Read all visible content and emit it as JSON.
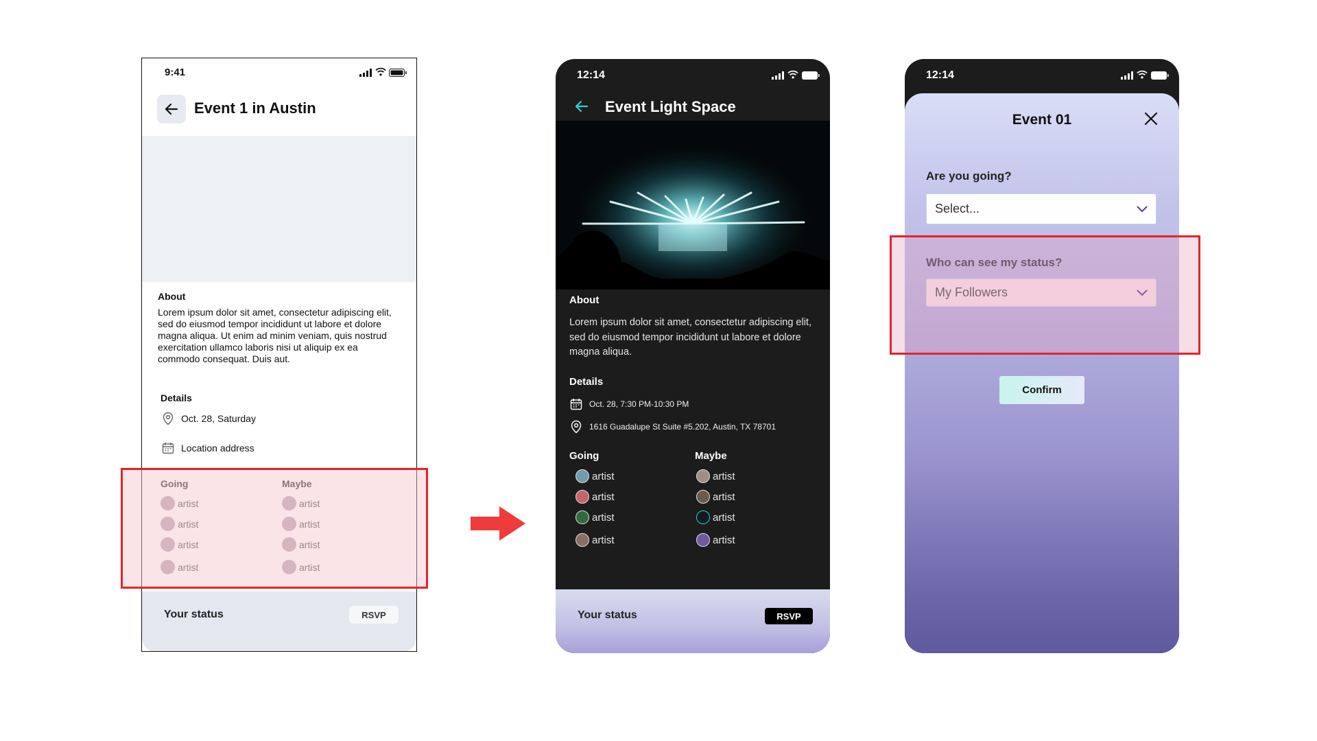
{
  "wireframe": {
    "time": "9:41",
    "title": "Event 1 in Austin",
    "about_heading": "About",
    "about_text": "Lorem ipsum dolor sit amet, consectetur adipiscing elit, sed do eiusmod tempor incididunt ut labore et dolore magna aliqua. Ut enim ad minim veniam, quis nostrud exercitation ullamco laboris nisi ut aliquip ex ea commodo consequat. Duis aut.",
    "details_heading": "Details",
    "date": "Oct. 28, Saturday",
    "location": "Location address",
    "going_heading": "Going",
    "maybe_heading": "Maybe",
    "going": [
      "artist",
      "artist",
      "artist",
      "artist"
    ],
    "maybe": [
      "artist",
      "artist",
      "artist",
      "artist"
    ],
    "status_label": "Your status",
    "rsvp_label": "RSVP"
  },
  "dark": {
    "time": "12:14",
    "title": "Event Light Space",
    "about_heading": "About",
    "about_text": "Lorem ipsum dolor sit amet, consectetur adipiscing elit, sed do eiusmod tempor incididunt ut labore et dolore magna aliqua.",
    "details_heading": "Details",
    "date": "Oct. 28,  7:30 PM-10:30 PM",
    "address": "1616 Guadalupe St Suite #5.202, Austin, TX 78701",
    "going_heading": "Going",
    "maybe_heading": "Maybe",
    "going": [
      "artist",
      "artist",
      "artist",
      "artist"
    ],
    "maybe": [
      "artist",
      "artist",
      "artist",
      "artist"
    ],
    "status_label": "Your status",
    "rsvp_label": "RSVP",
    "accent": "#2bd2d8"
  },
  "modal": {
    "time": "12:14",
    "title": "Event 01",
    "going_question": "Are you going?",
    "going_value": "Select...",
    "visibility_question": "Who can see my status?",
    "visibility_value": "My Followers",
    "confirm_label": "Confirm"
  },
  "colors": {
    "highlight": "#e5222a",
    "arrow": "#ef3b3b"
  }
}
